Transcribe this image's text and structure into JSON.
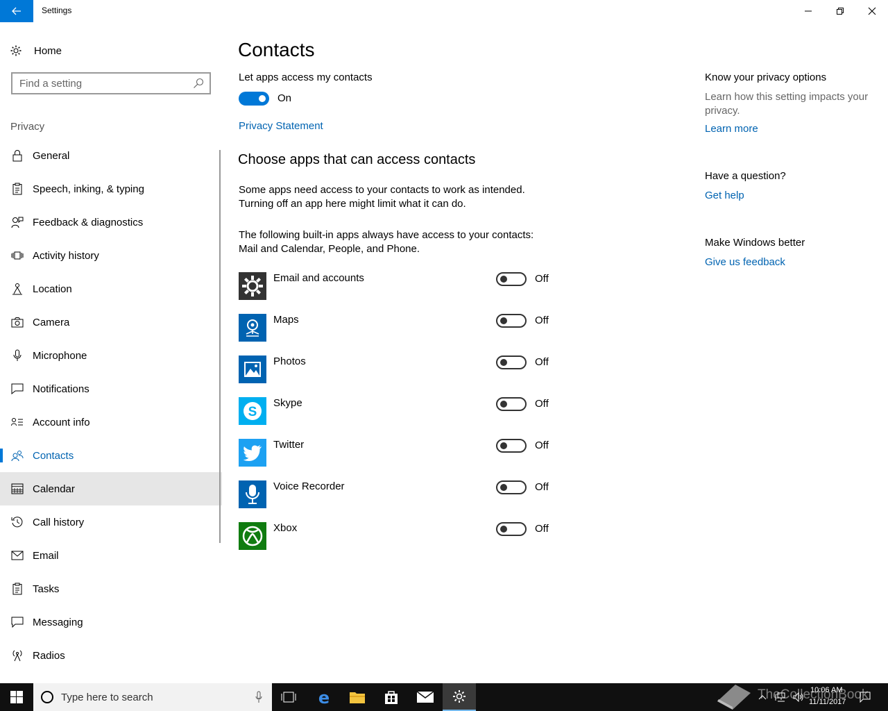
{
  "window": {
    "title": "Settings"
  },
  "sidebar": {
    "home_label": "Home",
    "search_placeholder": "Find a setting",
    "section": "Privacy",
    "items": [
      {
        "label": "General",
        "icon": "lock-icon"
      },
      {
        "label": "Speech, inking, & typing",
        "icon": "clipboard-icon"
      },
      {
        "label": "Feedback & diagnostics",
        "icon": "feedback-person-icon"
      },
      {
        "label": "Activity history",
        "icon": "activity-icon"
      },
      {
        "label": "Location",
        "icon": "location-person-icon"
      },
      {
        "label": "Camera",
        "icon": "camera-icon"
      },
      {
        "label": "Microphone",
        "icon": "microphone-icon"
      },
      {
        "label": "Notifications",
        "icon": "notification-icon"
      },
      {
        "label": "Account info",
        "icon": "account-info-icon"
      },
      {
        "label": "Contacts",
        "icon": "contacts-icon",
        "active": true
      },
      {
        "label": "Calendar",
        "icon": "calendar-icon",
        "hover": true
      },
      {
        "label": "Call history",
        "icon": "history-icon"
      },
      {
        "label": "Email",
        "icon": "mail-icon"
      },
      {
        "label": "Tasks",
        "icon": "tasks-icon"
      },
      {
        "label": "Messaging",
        "icon": "message-icon"
      },
      {
        "label": "Radios",
        "icon": "radio-tower-icon"
      }
    ]
  },
  "main": {
    "title": "Contacts",
    "access_label": "Let apps access my contacts",
    "access_state": "On",
    "privacy_link": "Privacy Statement",
    "choose_heading": "Choose apps that can access contacts",
    "desc1_line1": "Some apps need access to your contacts to work as intended.",
    "desc1_line2": "Turning off an app here might limit what it can do.",
    "desc2_line1": "The following built-in apps always have access to your contacts:",
    "desc2_line2": "Mail and Calendar, People, and Phone.",
    "apps": [
      {
        "name": "Email and accounts",
        "state": "Off",
        "icon": "gear-icon",
        "color": "#333333"
      },
      {
        "name": "Maps",
        "state": "Off",
        "icon": "maps-icon",
        "color": "#0063b1"
      },
      {
        "name": "Photos",
        "state": "Off",
        "icon": "photos-icon",
        "color": "#0063b1"
      },
      {
        "name": "Skype",
        "state": "Off",
        "icon": "skype-icon",
        "color": "#00aff0"
      },
      {
        "name": "Twitter",
        "state": "Off",
        "icon": "twitter-icon",
        "color": "#1da1f2"
      },
      {
        "name": "Voice Recorder",
        "state": "Off",
        "icon": "voice-recorder-icon",
        "color": "#0063b1"
      },
      {
        "name": "Xbox",
        "state": "Off",
        "icon": "xbox-icon",
        "color": "#107c10"
      }
    ]
  },
  "right": {
    "privacy_heading": "Know your privacy options",
    "privacy_text_line1": "Learn how this setting impacts your",
    "privacy_text_line2": "privacy.",
    "learn_more": "Learn more",
    "question_heading": "Have a question?",
    "get_help": "Get help",
    "better_heading": "Make Windows better",
    "feedback_link": "Give us feedback"
  },
  "taskbar": {
    "search_placeholder": "Type here to search",
    "time": "10:06 AM",
    "date": "11/11/2017",
    "watermark": "TheCollectionBook"
  },
  "colors": {
    "accent": "#0078d7",
    "link": "#0063b1",
    "taskbar": "#101010"
  }
}
